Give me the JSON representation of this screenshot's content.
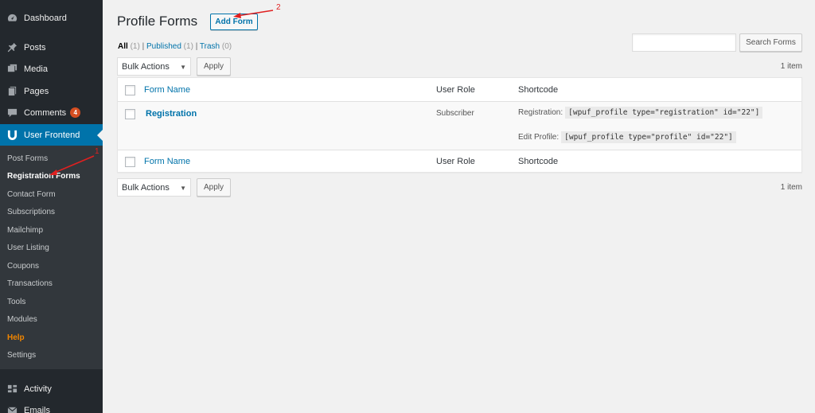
{
  "sidebar": {
    "top_items": [
      {
        "label": "Dashboard",
        "icon": "dashboard-icon"
      },
      {
        "label": "Posts",
        "icon": "pin-icon"
      },
      {
        "label": "Media",
        "icon": "media-icon"
      },
      {
        "label": "Pages",
        "icon": "pages-icon"
      },
      {
        "label": "Comments",
        "icon": "comment-icon",
        "badge": "4"
      },
      {
        "label": "User Frontend",
        "icon": "wpuf-icon"
      }
    ],
    "submenu": [
      "Post Forms",
      "Registration Forms",
      "Contact Form",
      "Subscriptions",
      "Mailchimp",
      "User Listing",
      "Coupons",
      "Transactions",
      "Tools",
      "Modules",
      "Help",
      "Settings"
    ],
    "bottom_items": [
      {
        "label": "Activity",
        "icon": "activity-icon"
      },
      {
        "label": "Emails",
        "icon": "email-icon"
      }
    ],
    "active_color": "#0073aa"
  },
  "header": {
    "title": "Profile Forms",
    "add_button": "Add Form"
  },
  "filters": {
    "all": "All",
    "all_count": "(1)",
    "published": "Published",
    "published_count": "(1)",
    "trash": "Trash",
    "trash_count": "(0)",
    "sep": "|"
  },
  "search": {
    "placeholder": "",
    "button": "Search Forms"
  },
  "bulk": {
    "select_label": "Bulk Actions",
    "apply": "Apply",
    "items_count": "1 item"
  },
  "table": {
    "columns": [
      "Form Name",
      "User Role",
      "Shortcode"
    ],
    "rows": [
      {
        "name": "Registration",
        "role": "Subscriber",
        "registration_label": "Registration:",
        "registration_code": "[wpuf_profile type=\"registration\" id=\"22\"]",
        "edit_label": "Edit Profile:",
        "edit_code": "[wpuf_profile type=\"profile\" id=\"22\"]"
      }
    ]
  },
  "annotations": {
    "one": "1",
    "two": "2",
    "color": "#e02020"
  }
}
